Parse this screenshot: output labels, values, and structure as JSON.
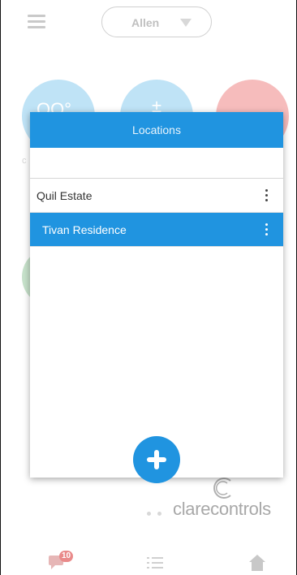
{
  "header": {
    "user_name": "Allen"
  },
  "tiles": {
    "tile1_text": "OO°",
    "tile1_label": "c",
    "tile2_text": "±"
  },
  "brand": {
    "text": "clarecontrols"
  },
  "bottom_nav": {
    "notification_count": "10"
  },
  "locations_modal": {
    "title": "Locations",
    "search_value": "",
    "items": [
      {
        "label": "Quil Estate",
        "selected": false
      },
      {
        "label": "Tivan Residence",
        "selected": true
      }
    ]
  },
  "colors": {
    "accent": "#2094e0",
    "tile_blue": "#bfe3f6",
    "tile_red": "#f6bcbc",
    "tile_green": "#c7e2cb"
  },
  "icons": {
    "menu": "hamburger-icon",
    "dropdown": "caret-down-icon",
    "more": "kebab-icon",
    "add": "plus-icon",
    "chat": "chat-icon",
    "list": "list-icon",
    "home": "home-icon"
  }
}
